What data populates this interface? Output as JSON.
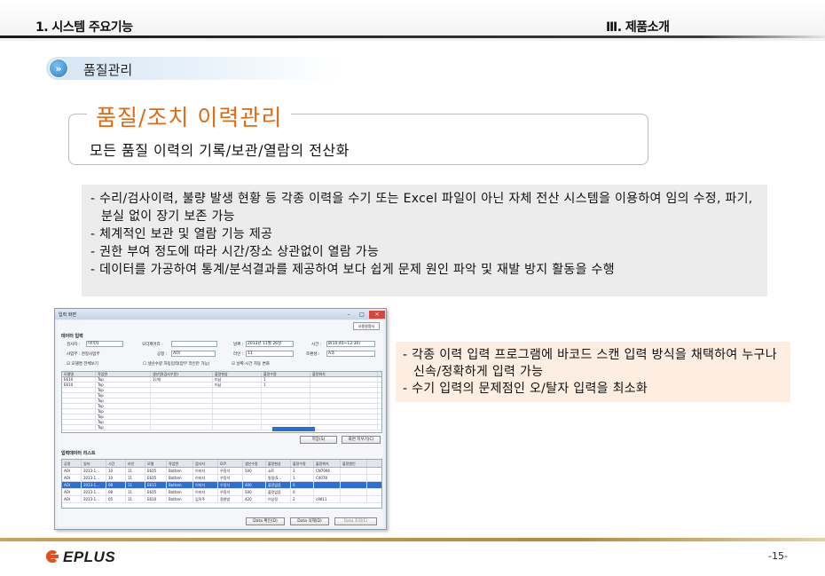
{
  "header": {
    "left_section": "1. 시스템 주요기능",
    "right_section": "Ⅲ. 제품소개"
  },
  "section": {
    "bullet_glyph": "»",
    "label": "품질관리"
  },
  "title": {
    "main": "품질/조치 이력관리",
    "subtitle": "모든 품질 이력의 기록/보관/열람의 전산화",
    "accent_color": "#e06a12"
  },
  "bullets": [
    "- 수리/검사이력, 불량 발생 현황 등 각종 이력을 수기 또는 Excel 파일이 아닌 자체 전산 시스템을   이용하여 임의 수정, 파기, 분실 없이 장기 보존 가능",
    "- 체계적인 보관 및 열람 기능 제공",
    "- 권한 부여 정도에 따라 시간/장소 상관없이 열람 가능",
    "- 데이터를 가공하여 통계/분석결과를 제공하여 보다 쉽게 문제 원인 파악 및 재발 방지 활동을 수행"
  ],
  "screenshot": {
    "window_title": "입력 화면",
    "window_buttons": [
      "–",
      "□",
      "✕"
    ],
    "user_button": "사용설명서",
    "group_input": "데이터 입력",
    "fields": {
      "inspector_label": "검사자 :",
      "inspector_value": "이미자",
      "order_label": "오더제어리 :",
      "order_value": "",
      "date_label": "날짜 :",
      "date_value": "2013년 11월 26일",
      "time_label": "시간 :",
      "time_value": "8(10:40~12:30)",
      "site_label": "사업부 : 천정사업부",
      "process_label": "공정 :",
      "process_value": "AOI",
      "line_label": "라인 :",
      "line_value": "11",
      "shift_label": "조편성 :",
      "shift_value": "A조",
      "check1": "☑ 모델명 전체보기",
      "check2": "☐ 생산수량 자동입력(압부 라인만 가능)",
      "check3": "☑ 날짜·시간 자동 변화"
    },
    "grid1_headers": [
      "모델명",
      "작업면",
      "생산량(검사수량)",
      "불량현상",
      "불량수량",
      "불량위치"
    ],
    "grid1_rows": [
      [
        "E610",
        "Top",
        "1(개)",
        "미납",
        "1",
        ""
      ],
      [
        "E610",
        "Top",
        "",
        "미납",
        "1",
        ""
      ],
      [
        "",
        "Top",
        "",
        "",
        "",
        ""
      ],
      [
        "",
        "Top",
        "",
        "",
        "",
        ""
      ],
      [
        "",
        "Top",
        "",
        "",
        "",
        ""
      ],
      [
        "",
        "Top",
        "",
        "",
        "",
        ""
      ],
      [
        "",
        "Top",
        "",
        "",
        "",
        ""
      ],
      [
        "",
        "Top",
        "",
        "",
        "",
        ""
      ],
      [
        "",
        "Top",
        "",
        "",
        "",
        ""
      ],
      [
        "",
        "Top",
        "",
        "",
        "",
        ""
      ]
    ],
    "save_button": "저장(S)",
    "clear_button": "화면 지우기(C)",
    "group_list": "입력데이터 리스트",
    "grid2_headers": [
      "공정",
      "일자",
      "시간",
      "라인",
      "모델",
      "작업면",
      "검사자",
      "O.P.",
      "생산수량",
      "불량현상",
      "불량수량",
      "불량위치",
      "불량원인"
    ],
    "grid2_rows": [
      [
        "AOI",
        "2013-1...",
        "10",
        "11",
        "E615",
        "Bottom",
        "이미자",
        "우정석",
        "500",
        "쇼트",
        "3",
        "CN7006",
        ""
      ],
      [
        "AOI",
        "2013-1...",
        "10",
        "11",
        "E615",
        "Bottom",
        "이미자",
        "우정석",
        "",
        "말림(S...",
        "1",
        "C4078",
        ""
      ],
      [
        "AOI",
        "2013-1...",
        "08",
        "11",
        "E615",
        "Bottom",
        "이미자",
        "우정석",
        "400",
        "불량없음",
        "0",
        "",
        ""
      ],
      [
        "AOI",
        "2013-1...",
        "08",
        "11",
        "E615",
        "Bottom",
        "이미자",
        "우정석",
        "500",
        "불량없음",
        "0",
        "",
        ""
      ],
      [
        "AOI",
        "2013-1...",
        "05",
        "11",
        "E610",
        "Bottom",
        "김옥주",
        "정원범",
        "420",
        "이상정",
        "2",
        "c9011",
        ""
      ]
    ],
    "bottom_buttons": [
      "Data 확인(D)",
      "Data 삭제(D)",
      "Data 조회(E)"
    ]
  },
  "notes": [
    "- 각종 이력 입력 프로그램에 바코드 스캔 입력 방식을 채택하여 누구나 신속/정확하게 입력 가능",
    "- 수기 입력의 문제점인 오/탈자 입력을 최소화"
  ],
  "footer": {
    "logo_text": "EPLUS",
    "page_number": "-15-"
  }
}
